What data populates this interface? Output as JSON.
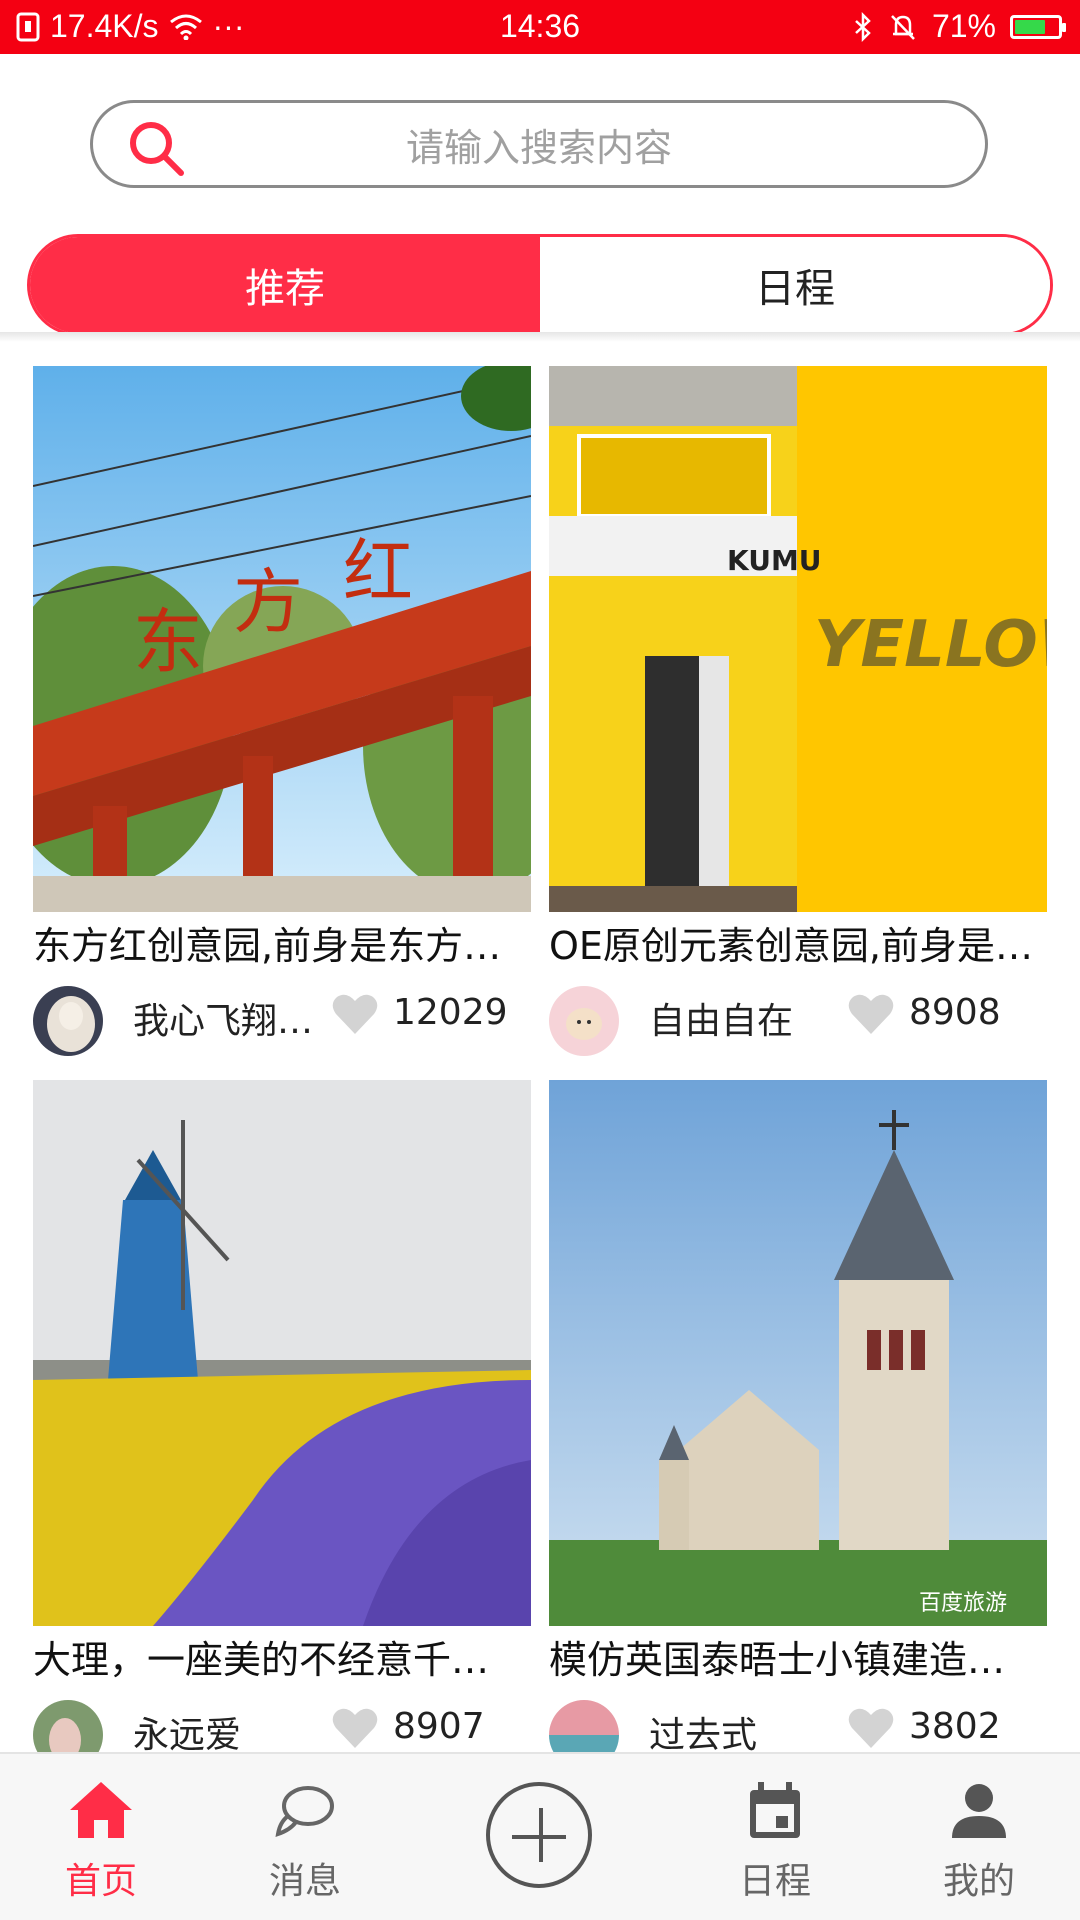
{
  "status_bar": {
    "speed": "17.4K/s",
    "dots": "···",
    "time": "14:36",
    "battery": "71%",
    "battery_level": 0.71
  },
  "search": {
    "placeholder": "请输入搜索内容"
  },
  "tabs": [
    {
      "label": "推荐",
      "active": true
    },
    {
      "label": "日程",
      "active": false
    }
  ],
  "cards": [
    {
      "title": "东方红创意园,前身是东方…",
      "author": "我心飞翔…",
      "likes": "12029",
      "image": "red-gate-photo"
    },
    {
      "title": "OE原创元素创意园,前身是…",
      "author": "自由自在",
      "likes": "8908",
      "image": "yellow-building-photo",
      "image_text": "YELLOW",
      "sign_text": "KUMU"
    },
    {
      "title": "大理，一座美的不经意千…",
      "author": "永远爱",
      "likes": "8907",
      "image": "windmill-flowers-photo"
    },
    {
      "title": "模仿英国泰晤士小镇建造…",
      "author": "过去式",
      "likes": "3802",
      "image": "church-photo",
      "watermark": "百度旅游"
    }
  ],
  "bottom_nav": [
    {
      "label": "首页",
      "icon": "home-icon",
      "active": true
    },
    {
      "label": "消息",
      "icon": "chat-icon",
      "active": false
    },
    {
      "label": "",
      "icon": "add-icon",
      "active": false
    },
    {
      "label": "日程",
      "icon": "calendar-icon",
      "active": false
    },
    {
      "label": "我的",
      "icon": "person-icon",
      "active": false
    }
  ],
  "colors": {
    "status_bar": "#f40012",
    "accent": "#ff2d47",
    "battery_fill": "#35d94a"
  }
}
